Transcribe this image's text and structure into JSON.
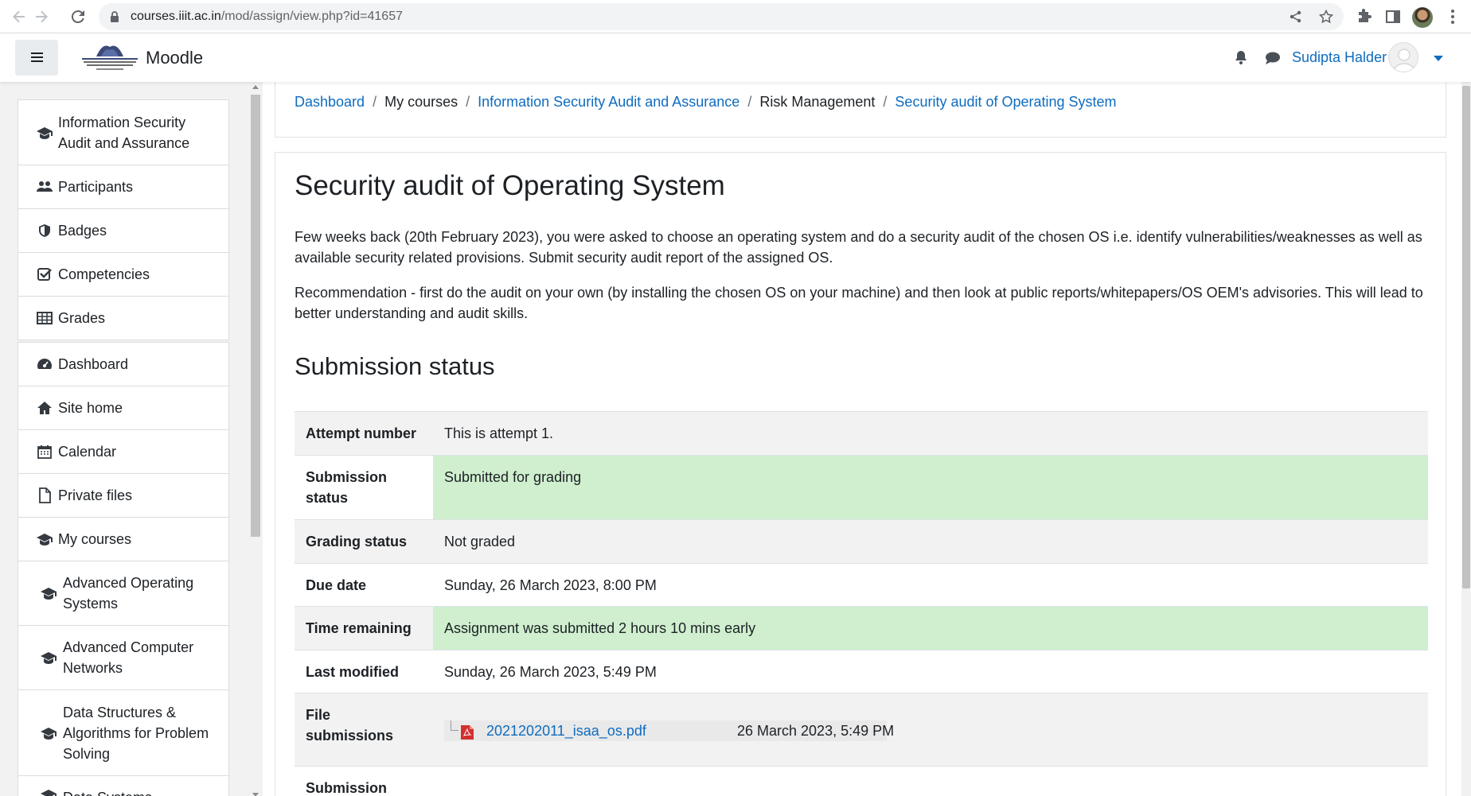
{
  "browser": {
    "url_host": "courses.iiit.ac.in",
    "url_path": "/mod/assign/view.php?id=41657"
  },
  "navbar": {
    "site_name": "Moodle",
    "user_name": "Sudipta Halder"
  },
  "drawer": {
    "course_nav": [
      {
        "label": "Information Security Audit and Assurance",
        "icon": "graduation-cap-icon"
      },
      {
        "label": "Participants",
        "icon": "users-icon"
      },
      {
        "label": "Badges",
        "icon": "shield-icon"
      },
      {
        "label": "Competencies",
        "icon": "checkbox-icon"
      },
      {
        "label": "Grades",
        "icon": "table-icon"
      }
    ],
    "site_nav": [
      {
        "label": "Dashboard",
        "icon": "dashboard-icon"
      },
      {
        "label": "Site home",
        "icon": "home-icon"
      },
      {
        "label": "Calendar",
        "icon": "calendar-icon"
      },
      {
        "label": "Private files",
        "icon": "file-icon"
      },
      {
        "label": "My courses",
        "icon": "graduation-cap-icon"
      }
    ],
    "courses": [
      "Advanced Operating Systems",
      "Advanced Computer Networks",
      "Data Structures & Algorithms for Problem Solving",
      "Data Systems"
    ]
  },
  "breadcrumb": [
    {
      "label": "Dashboard",
      "link": true
    },
    {
      "label": "My courses",
      "link": false
    },
    {
      "label": "Information Security Audit and Assurance",
      "link": true
    },
    {
      "label": "Risk Management",
      "link": false
    },
    {
      "label": "Security audit of Operating System",
      "link": true
    }
  ],
  "assignment": {
    "title": "Security audit of Operating System",
    "intro": [
      "Few weeks back (20th February 2023), you were asked to choose an operating system and do a security audit of the chosen OS i.e. identify vulnerabilities/weaknesses as well as available security related provisions. Submit security audit report of the assigned OS.",
      "Recommendation - first do the audit on your own (by installing the chosen OS on your machine) and then look at public reports/whitepapers/OS OEM's advisories. This will lead to better understanding and audit skills."
    ]
  },
  "submission": {
    "heading": "Submission status",
    "rows": [
      {
        "label": "Attempt number",
        "value": "This is attempt 1."
      },
      {
        "label": "Submission status",
        "value": "Submitted for grading"
      },
      {
        "label": "Grading status",
        "value": "Not graded"
      },
      {
        "label": "Due date",
        "value": "Sunday, 26 March 2023, 8:00 PM"
      },
      {
        "label": "Time remaining",
        "value": "Assignment was submitted 2 hours 10 mins early"
      },
      {
        "label": "Last modified",
        "value": "Sunday, 26 March 2023, 5:49 PM"
      },
      {
        "label": "File submissions",
        "file_name": "2021202011_isaa_os.pdf",
        "file_date": "26 March 2023, 5:49 PM"
      },
      {
        "label": "Submission"
      }
    ]
  },
  "colors": {
    "link": "#0f6cbf",
    "success_bg": "#cfefcf",
    "drawer_bg": "#f2f2f2"
  }
}
